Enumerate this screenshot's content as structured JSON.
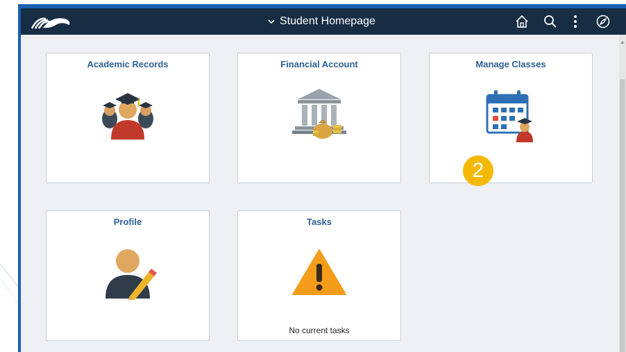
{
  "header": {
    "title": "Student Homepage"
  },
  "tiles": [
    {
      "title": "Academic Records",
      "icon": "graduates-icon"
    },
    {
      "title": "Financial Account",
      "icon": "bank-money-icon"
    },
    {
      "title": "Manage Classes",
      "icon": "calendar-graduate-icon"
    },
    {
      "title": "Profile",
      "icon": "user-edit-icon"
    },
    {
      "title": "Tasks",
      "icon": "warning-icon",
      "note": "No current tasks"
    }
  ],
  "callout": {
    "number": "2"
  },
  "colors": {
    "topbar": "#162d44",
    "tile_title": "#2b5f93",
    "badge": "#f5b800",
    "content_bg": "#eef0f3"
  }
}
